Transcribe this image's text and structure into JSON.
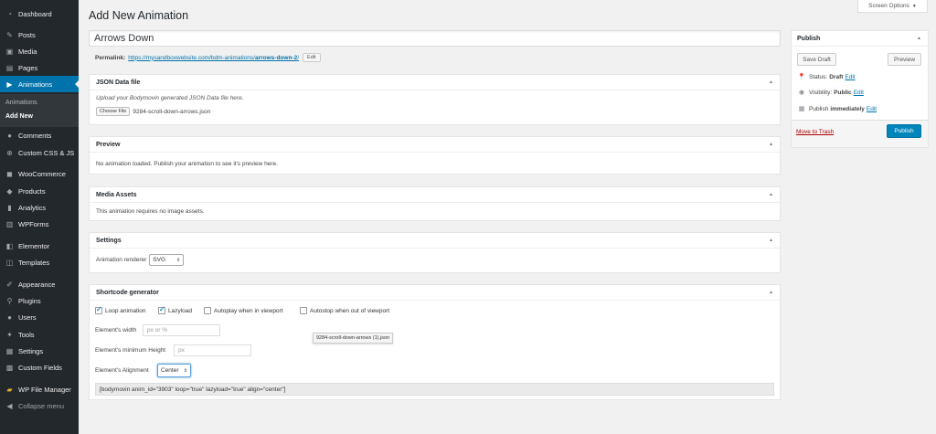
{
  "sidebar": {
    "items": [
      {
        "label": "Dashboard",
        "icon": "dashboard-icon"
      },
      {
        "label": "Posts",
        "icon": "pin-icon"
      },
      {
        "label": "Media",
        "icon": "media-icon"
      },
      {
        "label": "Pages",
        "icon": "pages-icon"
      },
      {
        "label": "Animations",
        "icon": "camera-icon",
        "active": true
      },
      {
        "label": "Comments",
        "icon": "comments-icon"
      },
      {
        "label": "Custom CSS & JS",
        "icon": "plus-icon"
      },
      {
        "label": "WooCommerce",
        "icon": "woocommerce-icon"
      },
      {
        "label": "Products",
        "icon": "products-icon"
      },
      {
        "label": "Analytics",
        "icon": "analytics-icon"
      },
      {
        "label": "WPForms",
        "icon": "forms-icon"
      },
      {
        "label": "Elementor",
        "icon": "elementor-icon"
      },
      {
        "label": "Templates",
        "icon": "templates-icon"
      },
      {
        "label": "Appearance",
        "icon": "brush-icon"
      },
      {
        "label": "Plugins",
        "icon": "plugin-icon"
      },
      {
        "label": "Users",
        "icon": "users-icon"
      },
      {
        "label": "Tools",
        "icon": "wrench-icon"
      },
      {
        "label": "Settings",
        "icon": "settings-icon"
      },
      {
        "label": "Custom Fields",
        "icon": "fields-icon"
      },
      {
        "label": "WP File Manager",
        "icon": "folder-icon"
      },
      {
        "label": "Collapse menu",
        "icon": "collapse-icon"
      }
    ],
    "submenu": [
      {
        "label": "Animations"
      },
      {
        "label": "Add New",
        "current": true
      }
    ]
  },
  "header": {
    "title": "Add New Animation",
    "screen_options": "Screen Options"
  },
  "post": {
    "title_value": "Arrows Down",
    "permalink_label": "Permalink:",
    "permalink_base": "https://mysandboxwebsite.com/bdm-animations/",
    "permalink_slug": "arrows-down-2",
    "permalink_trail": "/",
    "edit_label": "Edit"
  },
  "json_box": {
    "title": "JSON Data file",
    "description": "Upload your Bodymovin generated JSON Data file here.",
    "choose_label": "Choose File",
    "filename": "9284-scroll-down-arrows.json"
  },
  "preview_box": {
    "title": "Preview",
    "text": "No animation loaded. Publish your animation to see it's preview here."
  },
  "media_box": {
    "title": "Media Assets",
    "text": "This animation requires no image assets."
  },
  "settings_box": {
    "title": "Settings",
    "renderer_label": "Animation renderer",
    "renderer_value": "SVG"
  },
  "shortcode_box": {
    "title": "Shortcode generator",
    "loop_label": "Loop animation",
    "loop_checked": true,
    "lazyload_label": "Lazyload",
    "lazyload_checked": true,
    "autoplay_label": "Autoplay when in viewport",
    "autoplay_checked": false,
    "autostop_label": "Autostop when out of viewport",
    "autostop_checked": false,
    "width_label": "Element's width",
    "width_placeholder": "px or %",
    "min_height_label": "Element's minimum Height",
    "min_height_placeholder": "px",
    "alignment_label": "Element's Alignment",
    "alignment_value": "Center",
    "shortcode": "[bodymovin anim_id=\"3903\" loop=\"true\" lazyload=\"true\" align=\"center\"]",
    "tooltip": "9284-scroll-down-arrows (1).json"
  },
  "publish": {
    "title": "Publish",
    "save_draft": "Save Draft",
    "preview": "Preview",
    "status_label": "Status:",
    "status_value": "Draft",
    "visibility_label": "Visibility:",
    "visibility_value": "Public",
    "publish_label": "Publish",
    "publish_value": "immediately",
    "edit": "Edit",
    "trash": "Move to Trash",
    "publish_button": "Publish"
  },
  "colors": {
    "sidebar_bg": "#23282d",
    "accent": "#0073aa",
    "primary_button": "#0085ba",
    "trash": "#a00"
  }
}
